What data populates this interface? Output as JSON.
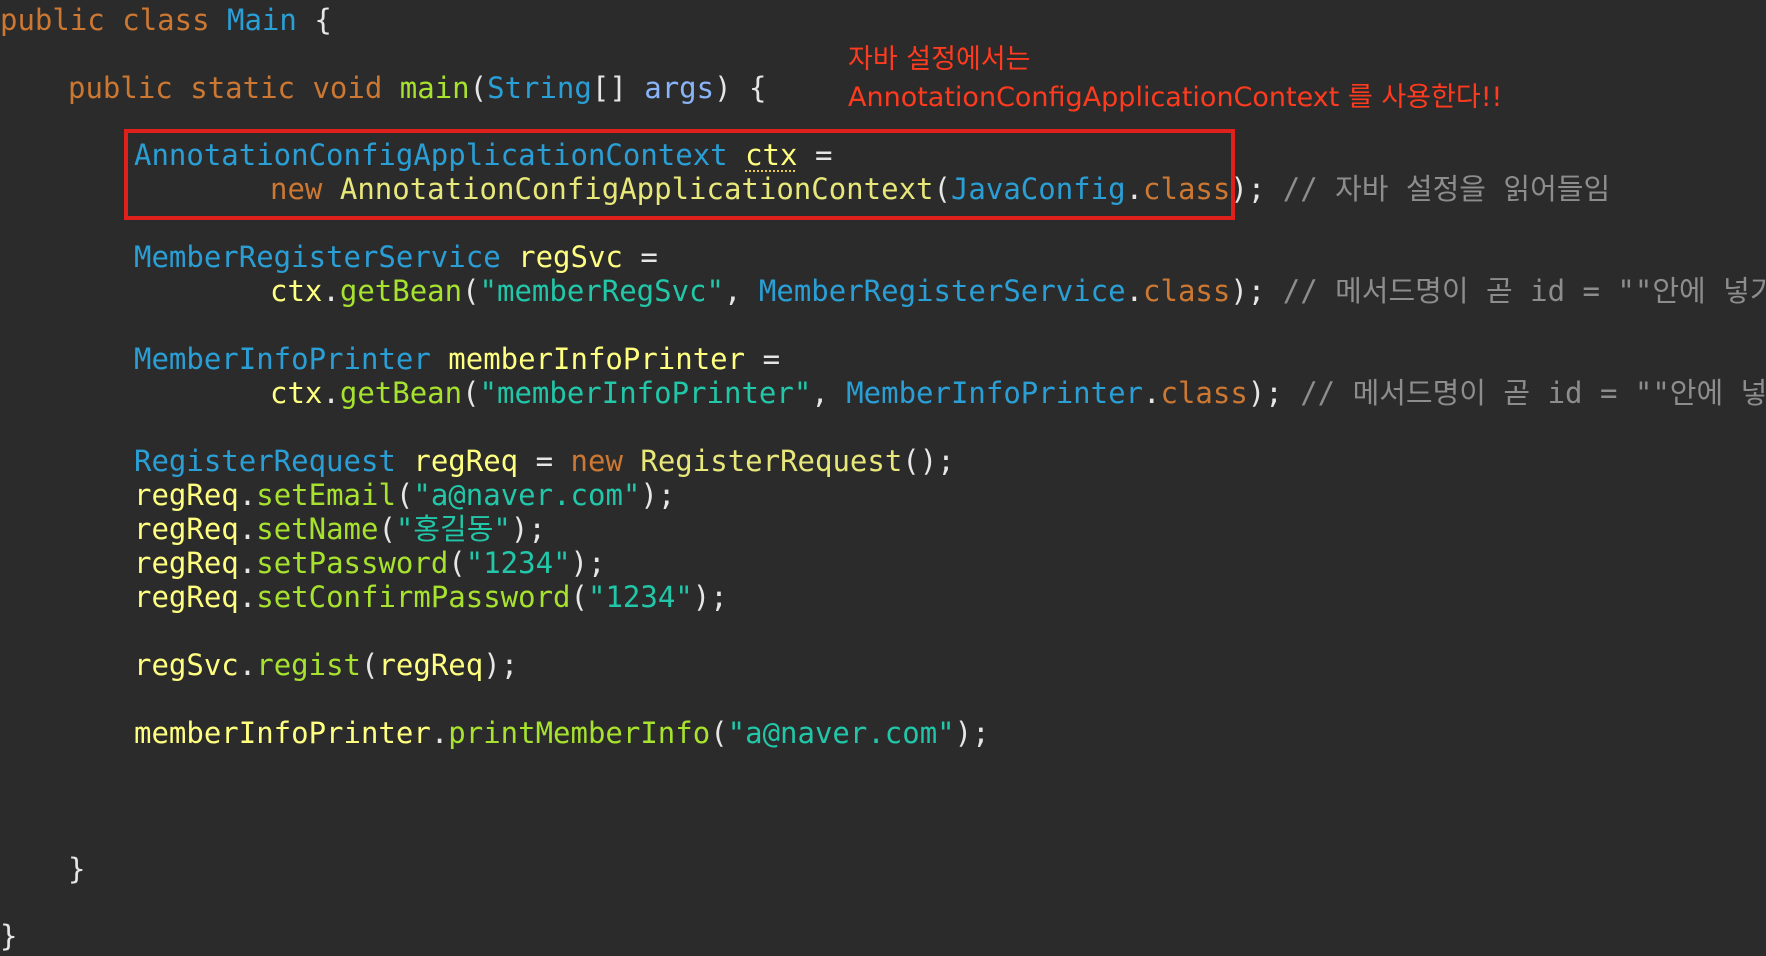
{
  "annotation": {
    "line1": "자바 설정에서는",
    "line2": "AnnotationConfigApplicationContext 를 사용한다!!",
    "color": "#ff3b1f",
    "box_color": "#e0201a"
  },
  "code": {
    "class_decl": {
      "kw1": "public",
      "kw2": "class",
      "name": "Main",
      "brace": "{"
    },
    "main_decl": {
      "kw1": "public",
      "kw2": "static",
      "kw3": "void",
      "fn": "main",
      "type": "String",
      "param": "args",
      "brace": "{"
    },
    "ctx_decl": {
      "type": "AnnotationConfigApplicationContext",
      "var": "ctx",
      "op": "="
    },
    "ctx_init": {
      "kw": "new",
      "ctor": "AnnotationConfigApplicationContext",
      "cfg_type": "JavaConfig",
      "cls": "class",
      "comment": "// 자바 설정을 읽어들임"
    },
    "regsvc_decl": {
      "type": "MemberRegisterService",
      "var": "regSvc",
      "op": "="
    },
    "regsvc_init": {
      "obj": "ctx",
      "fn": "getBean",
      "arg": "\"memberRegSvc\"",
      "type": "MemberRegisterService",
      "cls": "class",
      "comment": "// 메서드명이 곧 id = \"\"안에 넣기"
    },
    "printer_decl": {
      "type": "MemberInfoPrinter",
      "var": "memberInfoPrinter",
      "op": "="
    },
    "printer_init": {
      "obj": "ctx",
      "fn": "getBean",
      "arg": "\"memberInfoPrinter\"",
      "type": "MemberInfoPrinter",
      "cls": "class",
      "comment": "// 메서드명이 곧 id = \"\"안에 넣기"
    },
    "regreq_decl": {
      "type": "RegisterRequest",
      "var": "regReq",
      "kw": "new",
      "ctor": "RegisterRequest"
    },
    "set_email": {
      "obj": "regReq",
      "fn": "setEmail",
      "arg": "\"a@naver.com\""
    },
    "set_name": {
      "obj": "regReq",
      "fn": "setName",
      "arg": "\"홍길동\""
    },
    "set_password": {
      "obj": "regReq",
      "fn": "setPassword",
      "arg": "\"1234\""
    },
    "set_confirm": {
      "obj": "regReq",
      "fn": "setConfirmPassword",
      "arg": "\"1234\""
    },
    "regist_call": {
      "obj": "regSvc",
      "fn": "regist",
      "arg": "regReq"
    },
    "print_call": {
      "obj": "memberInfoPrinter",
      "fn": "printMemberInfo",
      "arg": "\"a@naver.com\""
    },
    "main_close": "}",
    "class_close": "}"
  }
}
